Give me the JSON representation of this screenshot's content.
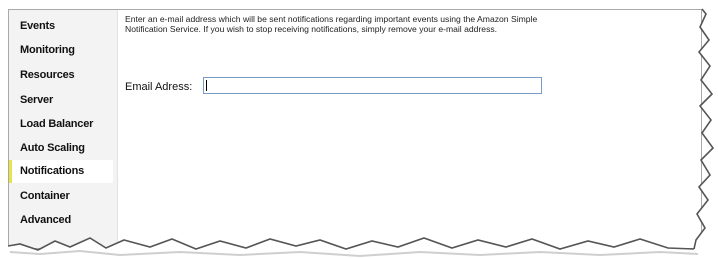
{
  "sidebar": {
    "items": [
      {
        "label": "Events"
      },
      {
        "label": "Monitoring"
      },
      {
        "label": "Resources"
      },
      {
        "label": "Server"
      },
      {
        "label": "Load Balancer"
      },
      {
        "label": "Auto Scaling"
      },
      {
        "label": "Notifications",
        "selected": true
      },
      {
        "label": "Container"
      },
      {
        "label": "Advanced"
      }
    ]
  },
  "main": {
    "description": "Enter an e-mail address which will be sent notifications regarding important events using the Amazon Simple Notification Service. If you wish to stop receiving notifications, simply remove your e-mail address.",
    "email_label": "Email Adress:",
    "email_value": ""
  },
  "colors": {
    "selected_accent": "#e8e34a",
    "sidebar_bg": "#f3f3f3",
    "input_border": "#7a9cc4"
  }
}
